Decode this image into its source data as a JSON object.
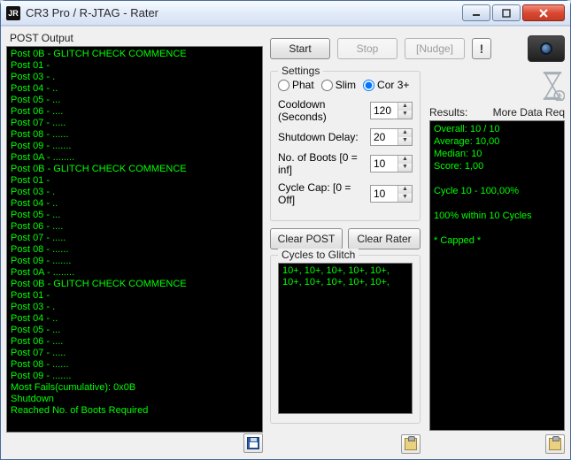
{
  "window": {
    "app_icon_text": "JR",
    "title": "CR3 Pro / R-JTAG - Rater"
  },
  "left": {
    "title": "POST Output",
    "lines": [
      "Post 0B - GLITCH CHECK COMMENCE",
      "Post 01 -",
      "Post 03 - .",
      "Post 04 - ..",
      "Post 05 - ...",
      "Post 06 - ....",
      "Post 07 - .....",
      "Post 08 - ......",
      "Post 09 - .......",
      "Post 0A - ........",
      "Post 0B - GLITCH CHECK COMMENCE",
      "Post 01 -",
      "Post 03 - .",
      "Post 04 - ..",
      "Post 05 - ...",
      "Post 06 - ....",
      "Post 07 - .....",
      "Post 08 - ......",
      "Post 09 - .......",
      "Post 0A - ........",
      "Post 0B - GLITCH CHECK COMMENCE",
      "Post 01 -",
      "Post 03 - .",
      "Post 04 - ..",
      "Post 05 - ...",
      "Post 06 - ....",
      "Post 07 - .....",
      "Post 08 - ......",
      "Post 09 - .......",
      "Most Fails(cumulative): 0x0B",
      "Shutdown",
      "Reached No. of Boots Required"
    ]
  },
  "toolbar": {
    "start": "Start",
    "stop": "Stop",
    "nudge": "[Nudge]",
    "excl": "!"
  },
  "settings": {
    "legend": "Settings",
    "radio_phat": "Phat",
    "radio_slim": "Slim",
    "radio_cor": "Cor 3+",
    "cooldown_label": "Cooldown (Seconds)",
    "cooldown_value": "120",
    "shutdown_label": "Shutdown Delay:",
    "shutdown_value": "20",
    "boots_label": "No. of Boots [0 = inf]",
    "boots_value": "10",
    "cycle_label": "Cycle Cap:   [0 = Off]",
    "cycle_value": "10",
    "clear_post": "Clear POST",
    "clear_rater": "Clear Rater",
    "cycles_legend": "Cycles to Glitch",
    "cycles_text": "10+, 10+, 10+, 10+, 10+, 10+, 10+, 10+, 10+, 10+,"
  },
  "results": {
    "head_label": "Results:",
    "head_value": "More Data Req",
    "lines": [
      "Overall: 10 / 10",
      "Average: 10,00",
      "Median: 10",
      "Score: 1,00",
      "",
      "Cycle 10 - 100,00%",
      "",
      "100% within 10 Cycles",
      "",
      "* Capped *"
    ]
  }
}
